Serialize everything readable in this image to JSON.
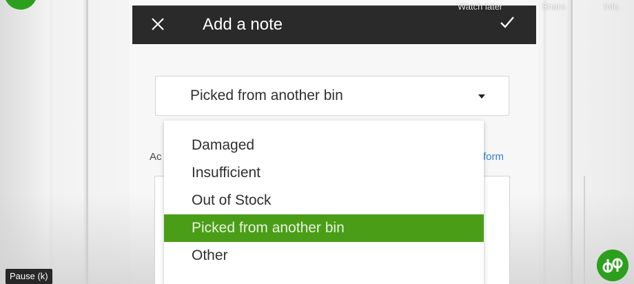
{
  "header": {
    "title": "Add a note",
    "close_icon": "close-icon",
    "confirm_icon": "check-icon"
  },
  "select": {
    "value": "Picked from another bin",
    "caret_icon": "caret-down-icon"
  },
  "dropdown": {
    "options": [
      {
        "label": "Damaged",
        "selected": false
      },
      {
        "label": "Insufficient",
        "selected": false
      },
      {
        "label": "Out of Stock",
        "selected": false
      },
      {
        "label": "Picked from another bin",
        "selected": true
      },
      {
        "label": "Other",
        "selected": false
      }
    ],
    "selected_color": "#4a9e17"
  },
  "background": {
    "label_partial": "Ac",
    "link_partial": "form"
  },
  "video_overlay": {
    "watch_later": "Watch later",
    "share": "Share",
    "info": "Info",
    "pause": "Pause (k)"
  },
  "colors": {
    "header_bg": "#2a2a2a",
    "brand_green": "#2ca01c"
  }
}
